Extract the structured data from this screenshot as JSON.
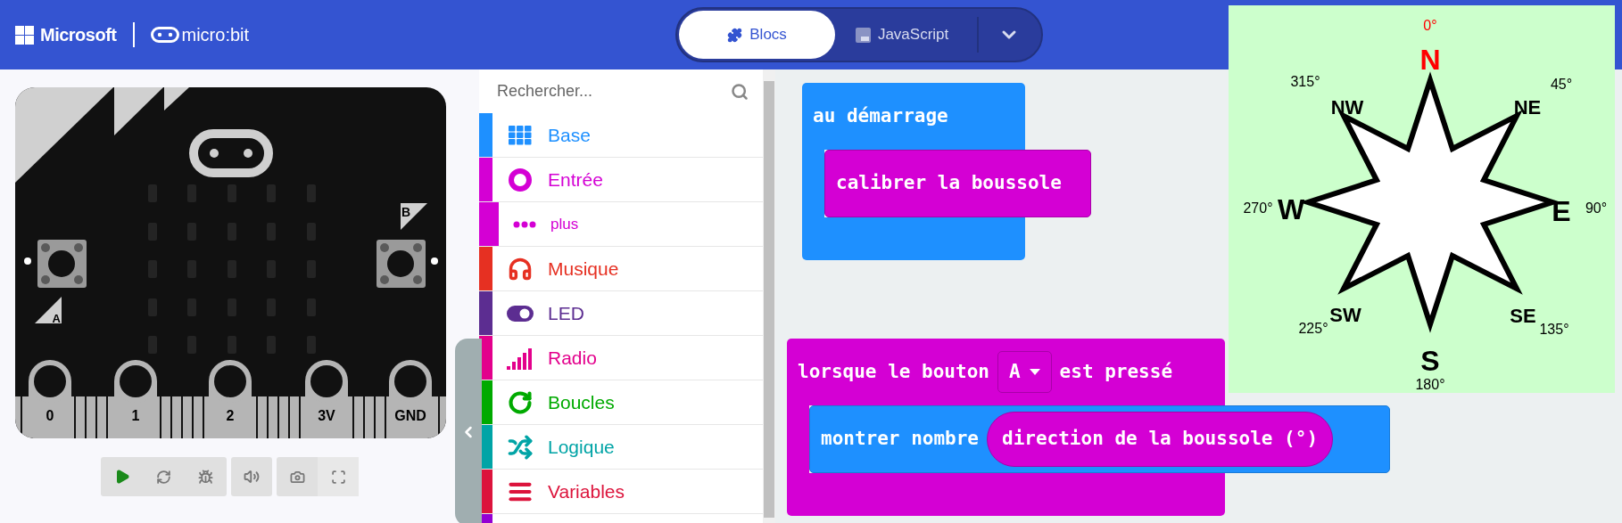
{
  "header": {
    "brand": "Microsoft",
    "product": "micro:bit",
    "tabs": [
      {
        "label": "Blocs",
        "kind": "blocks",
        "selected": true
      },
      {
        "label": "JavaScript",
        "kind": "js",
        "selected": false
      }
    ]
  },
  "simulator": {
    "button_labels": [
      "A",
      "B"
    ],
    "pins": [
      "0",
      "1",
      "2",
      "3V",
      "GND"
    ]
  },
  "toolbox": {
    "search": {
      "placeholder": "Rechercher..."
    },
    "categories": [
      {
        "label": "Base",
        "kind": "grid",
        "color": "#1e90ff"
      },
      {
        "label": "Entrée",
        "kind": "target",
        "color": "#d400d4",
        "children": [
          {
            "label": "plus",
            "kind": "dots",
            "color": "#d400d4"
          }
        ]
      },
      {
        "label": "Musique",
        "kind": "headphones",
        "color": "#e63022"
      },
      {
        "label": "LED",
        "kind": "toggle",
        "color": "#5c2d91"
      },
      {
        "label": "Radio",
        "kind": "signal",
        "color": "#e3008c"
      },
      {
        "label": "Boucles",
        "kind": "loop",
        "color": "#00aa00"
      },
      {
        "label": "Logique",
        "kind": "shuffle",
        "color": "#00a4a6"
      },
      {
        "label": "Variables",
        "kind": "lines",
        "color": "#dc143c"
      }
    ]
  },
  "workspace": {
    "on_start": {
      "label": "au démarrage",
      "body": {
        "label": "calibrer la boussole"
      }
    },
    "on_button": {
      "label_before": "lorsque le bouton",
      "dropdown": "A",
      "label_after": "est pressé",
      "body": {
        "label": "montrer nombre",
        "argument": "direction de la boussole (°)"
      }
    }
  },
  "compass": {
    "points": [
      {
        "label": "N",
        "degrees": "0°",
        "color": "#ff0000"
      },
      {
        "label": "NE",
        "degrees": "45°",
        "color": "#000000"
      },
      {
        "label": "E",
        "degrees": "90°",
        "color": "#000000"
      },
      {
        "label": "SE",
        "degrees": "135°",
        "color": "#000000"
      },
      {
        "label": "S",
        "degrees": "180°",
        "color": "#000000"
      },
      {
        "label": "SW",
        "degrees": "225°",
        "color": "#000000"
      },
      {
        "label": "W",
        "degrees": "270°",
        "color": "#000000"
      },
      {
        "label": "NW",
        "degrees": "315°",
        "color": "#000000"
      }
    ]
  }
}
